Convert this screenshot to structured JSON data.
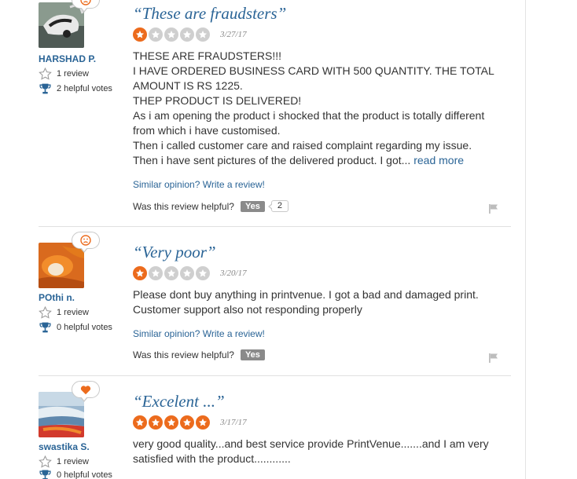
{
  "reviews": [
    {
      "title": "“These are fraudsters”",
      "rating": 1,
      "date": "3/27/17",
      "mood": "sad",
      "user": {
        "name": "HARSHAD P.",
        "reviews": "1 review",
        "helpful_votes": "2 helpful votes"
      },
      "body_lines": [
        "THESE ARE FRAUDSTERS!!!",
        "I HAVE ORDERED BUSINESS CARD WITH 500 QUANTITY. THE TOTAL",
        "AMOUNT IS RS 1225.",
        "THEP PRODUCT IS DELIVERED!",
        "As i am opening the product i shocked that the product is totally different",
        "from which i have customised.",
        "Then i called customer care and raised complaint regarding my issue.",
        "Then i have sent pictures of the delivered product. I got..."
      ],
      "read_more": "read more",
      "similar_link": "Similar opinion? Write a review!",
      "helpful_question": "Was this review helpful?",
      "yes_label": "Yes",
      "yes_count": "2"
    },
    {
      "title": "“Very poor”",
      "rating": 1,
      "date": "3/20/17",
      "mood": "sad",
      "user": {
        "name": "POthi n.",
        "reviews": "1 review",
        "helpful_votes": "0 helpful votes"
      },
      "body_lines": [
        "Please dont buy anything in printvenue. I got a bad and damaged print.",
        "Customer support also not responding properly"
      ],
      "similar_link": "Similar opinion? Write a review!",
      "helpful_question": "Was this review helpful?",
      "yes_label": "Yes"
    },
    {
      "title": "“Excelent ...”",
      "rating": 5,
      "date": "3/17/17",
      "mood": "heart",
      "user": {
        "name": "swastika S.",
        "reviews": "1 review",
        "helpful_votes": "0 helpful votes"
      },
      "body_lines": [
        "very good quality...and best service provide PrintVenue.......and I am very",
        "satisfied with the product............"
      ]
    }
  ],
  "colors": {
    "link": "#2a6496",
    "star_on": "#ec6b1d",
    "star_off": "#cfcfcf",
    "yes_button": "#8a8a8a"
  },
  "icons": {
    "mood_sad": "sad-face-icon",
    "mood_heart": "heart-icon",
    "review_count": "star-outline-icon",
    "helpful_votes": "trophy-icon",
    "report": "flag-icon"
  }
}
